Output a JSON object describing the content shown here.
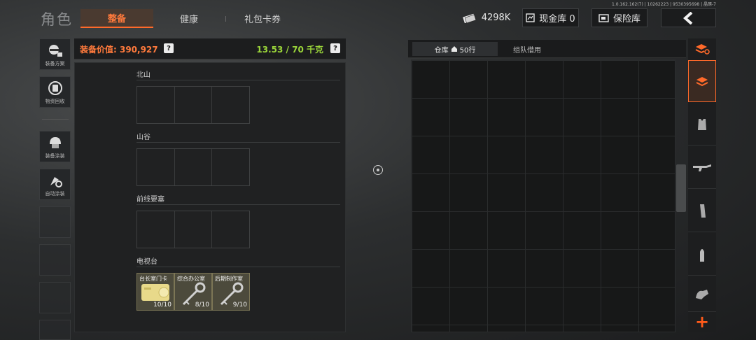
{
  "version_text": "1.0.162.162(7) | 10262223 | 9530395698 | 晶琢-7",
  "header": {
    "title": "角色",
    "tabs": [
      {
        "label": "整备",
        "active": true
      },
      {
        "label": "健康",
        "active": false
      },
      {
        "label": "礼包卡券",
        "active": false
      }
    ],
    "money": "4298K",
    "cash_vault": "现金库 0",
    "safe_box": "保险库",
    "back_icon": "chevron-left-icon"
  },
  "sidebar": {
    "items": [
      {
        "label": "装备方案",
        "icon": "loadout-plan-icon"
      },
      {
        "label": "物资回收",
        "icon": "recycle-icon"
      },
      {
        "label": "装备涂装",
        "icon": "helmet-paint-icon"
      },
      {
        "label": "自动涂装",
        "icon": "auto-paint-icon"
      }
    ]
  },
  "loadout": {
    "value_label": "装备价值: 390,927",
    "weight_label": "13.53 / 70 千克",
    "help": "?",
    "sections": [
      {
        "title": "北山"
      },
      {
        "title": "山谷"
      },
      {
        "title": "前线要塞"
      },
      {
        "title": "电视台"
      }
    ],
    "tv_items": [
      {
        "name": "台长室门卡",
        "count": "10/10",
        "icon": "keycard-icon"
      },
      {
        "name": "综合办公室",
        "count": "8/10",
        "icon": "key-icon"
      },
      {
        "name": "后期制作室",
        "count": "9/10",
        "icon": "key-icon"
      }
    ]
  },
  "warehouse": {
    "tab_storage": "仓库",
    "rows": "50行",
    "tab_team": "组队借用"
  },
  "filters": {
    "icons": [
      "stack-refresh-icon",
      "all-items-icon",
      "armor-icon",
      "rifle-icon",
      "magazine-icon",
      "ammo-icon",
      "misc-icon"
    ],
    "add": "+"
  },
  "colors": {
    "accent": "#ff6a2a",
    "weight_ok": "#9bd63a"
  }
}
